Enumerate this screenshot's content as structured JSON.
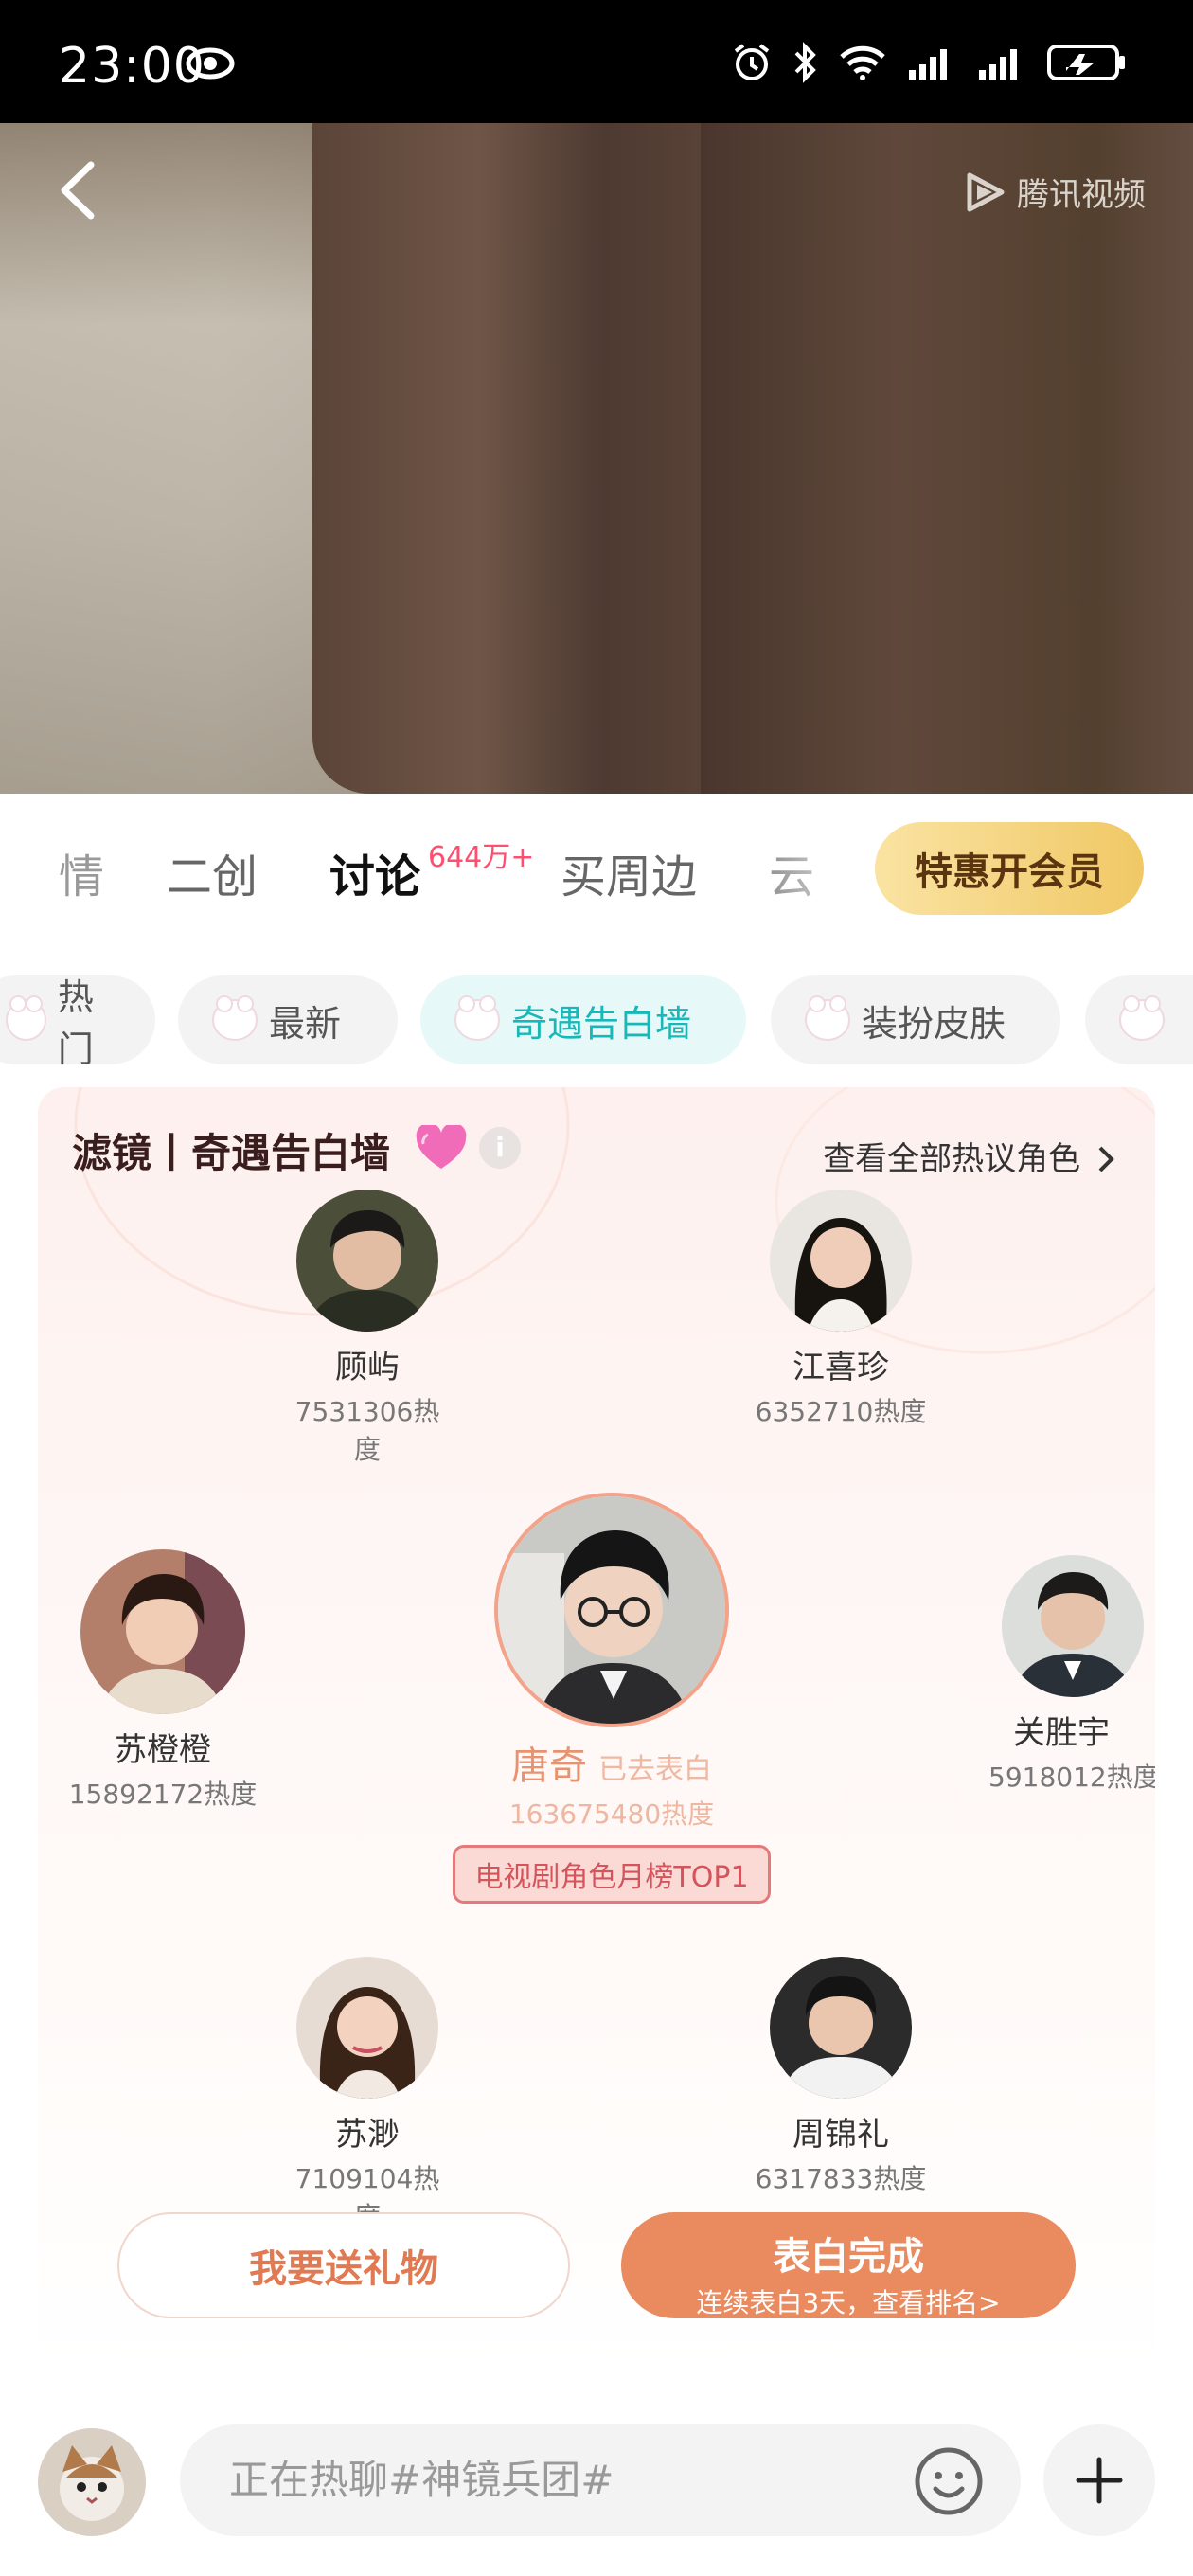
{
  "status_bar": {
    "time": "23:00"
  },
  "video": {
    "brand": "腾讯视频"
  },
  "tabs": {
    "items": [
      {
        "label": "情"
      },
      {
        "label": "二创"
      },
      {
        "label": "讨论"
      },
      {
        "label": "买周边"
      },
      {
        "label": "云"
      }
    ],
    "active_badge": "644万+",
    "vip_button": "特惠开会员"
  },
  "chips": [
    {
      "label": "热门"
    },
    {
      "label": "最新"
    },
    {
      "label": "奇遇告白墙"
    },
    {
      "label": "装扮皮肤"
    }
  ],
  "card": {
    "title": "滤镜丨奇遇告白墙",
    "info": "i",
    "see_all": "查看全部热议角色",
    "people": [
      {
        "name": "顾屿",
        "heat": "7531306热度"
      },
      {
        "name": "江喜珍",
        "heat": "6352710热度"
      },
      {
        "name": "苏橙橙",
        "heat": "15892172热度"
      },
      {
        "name": "关胜宇",
        "heat": "5918012热度"
      },
      {
        "name": "苏渺",
        "heat": "7109104热度"
      },
      {
        "name": "周锦礼",
        "heat": "6317833热度"
      }
    ],
    "center": {
      "name": "唐奇",
      "status": "已去表白",
      "heat": "163675480热度",
      "rank_badge": "电视剧角色月榜TOP1"
    },
    "gift_button": "我要送礼物",
    "confess_button": "表白完成",
    "confess_sub": "连续表白3天，查看排名>"
  },
  "bottom": {
    "input_placeholder": "正在热聊#神镜兵团#"
  },
  "colors": {
    "accent": "#ea8a5f",
    "chip_active": "#19b7b7",
    "badge": "#ff4f6f",
    "vip_gold": "#f0c865"
  }
}
